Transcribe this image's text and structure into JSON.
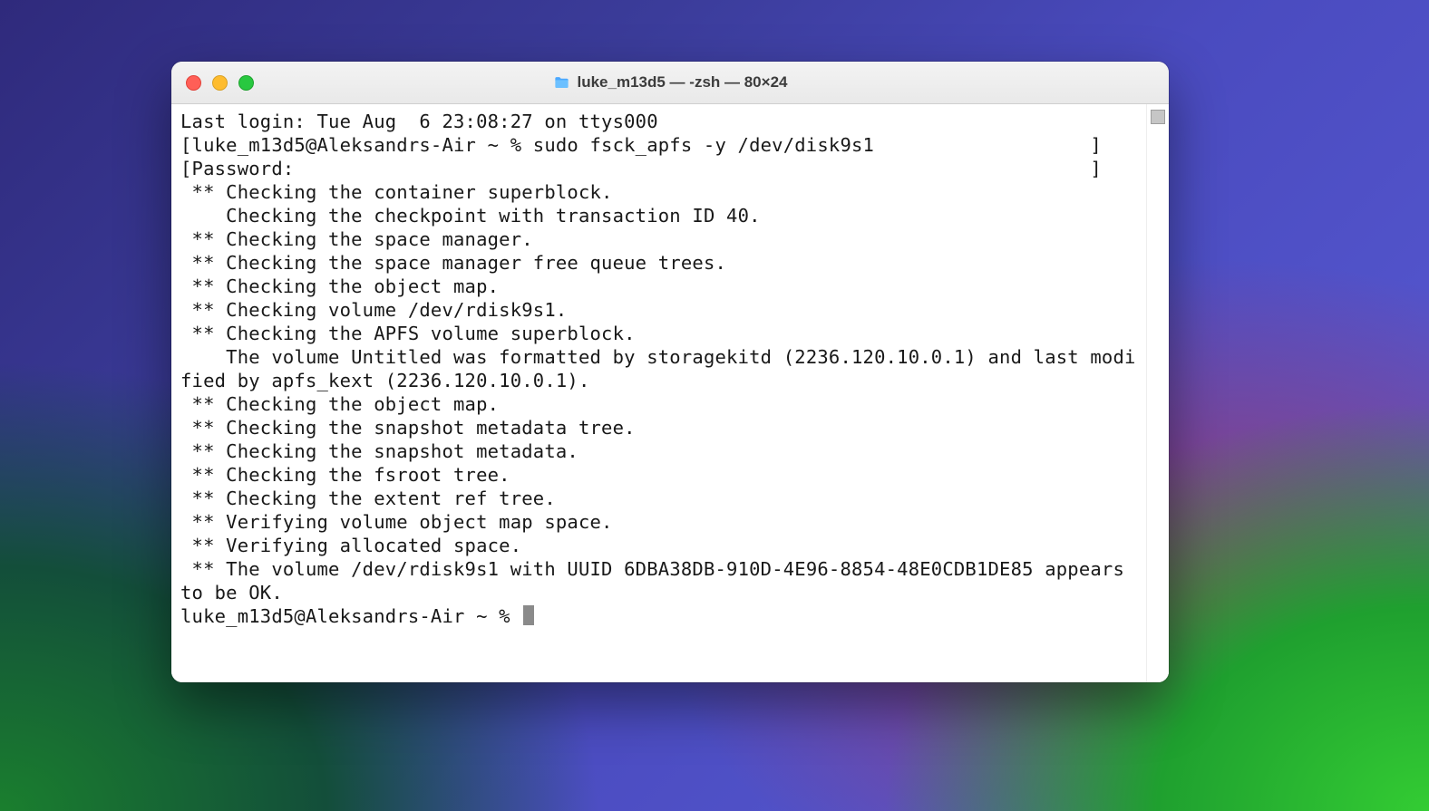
{
  "window": {
    "title": "luke_m13d5 — -zsh — 80×24"
  },
  "terminal": {
    "lines": [
      "Last login: Tue Aug  6 23:08:27 on ttys000",
      "[luke_m13d5@Aleksandrs-Air ~ % sudo fsck_apfs -y /dev/disk9s1                   ]",
      "[Password:                                                                      ]",
      " ** Checking the container superblock.",
      "    Checking the checkpoint with transaction ID 40.",
      " ** Checking the space manager.",
      " ** Checking the space manager free queue trees.",
      " ** Checking the object map.",
      " ** Checking volume /dev/rdisk9s1.",
      " ** Checking the APFS volume superblock.",
      "    The volume Untitled was formatted by storagekitd (2236.120.10.0.1) and last modified by apfs_kext (2236.120.10.0.1).",
      " ** Checking the object map.",
      " ** Checking the snapshot metadata tree.",
      " ** Checking the snapshot metadata.",
      " ** Checking the fsroot tree.",
      " ** Checking the extent ref tree.",
      " ** Verifying volume object map space.",
      " ** Verifying allocated space.",
      " ** The volume /dev/rdisk9s1 with UUID 6DBA38DB-910D-4E96-8854-48E0CDB1DE85 appears to be OK.",
      "luke_m13d5@Aleksandrs-Air ~ % "
    ]
  }
}
